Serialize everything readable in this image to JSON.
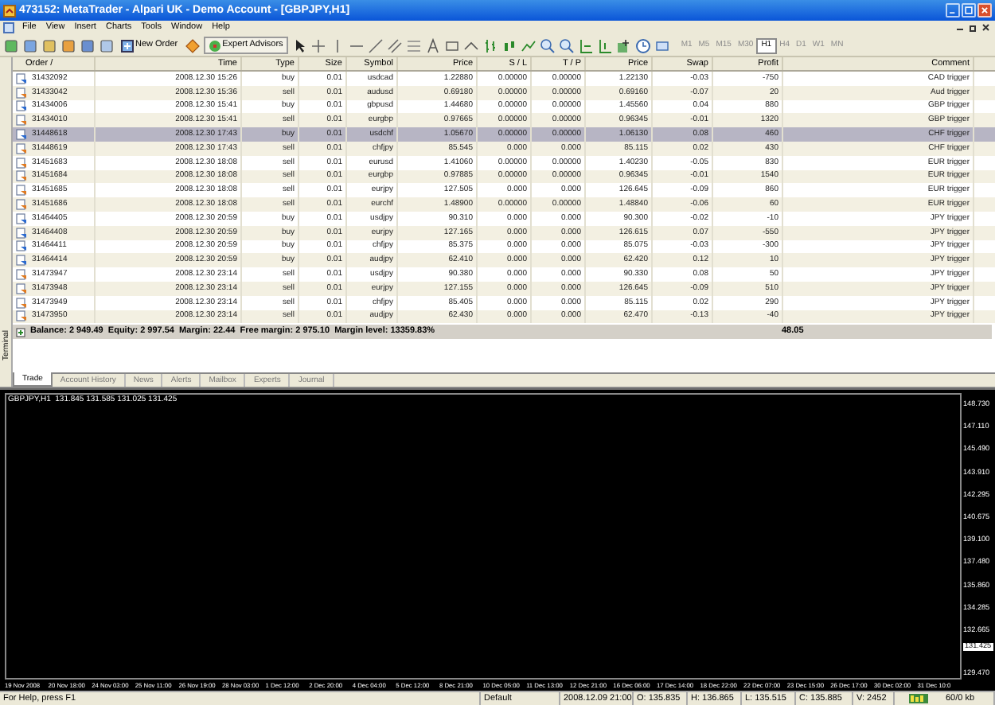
{
  "window": {
    "title": "473152: MetaTrader - Alpari UK - Demo Account - [GBPJPY,H1]"
  },
  "menu": [
    "File",
    "View",
    "Insert",
    "Charts",
    "Tools",
    "Window",
    "Help"
  ],
  "toolbar": {
    "buttons": [
      "New Order",
      "Expert Advisors"
    ],
    "timeframes": [
      {
        "label": "M1",
        "selected": false
      },
      {
        "label": "M5",
        "selected": false
      },
      {
        "label": "M15",
        "selected": false
      },
      {
        "label": "M30",
        "selected": false
      },
      {
        "label": "H1",
        "selected": true
      },
      {
        "label": "H4",
        "selected": false
      },
      {
        "label": "D1",
        "selected": false
      },
      {
        "label": "W1",
        "selected": false
      },
      {
        "label": "MN",
        "selected": false
      }
    ]
  },
  "terminal": {
    "side_label": "Terminal",
    "columns": [
      "Order  /",
      "Time",
      "Type",
      "Size",
      "Symbol",
      "Price",
      "S / L",
      "T / P",
      "Price",
      "Swap",
      "Profit",
      "Comment"
    ],
    "rows": [
      {
        "kind": "buy",
        "selected": false,
        "cells": [
          "31432092",
          "2008.12.30 15:26",
          "buy",
          "0.01",
          "usdcad",
          "1.22880",
          "0.00000",
          "0.00000",
          "1.22130",
          "-0.03",
          "-750",
          "CAD trigger"
        ]
      },
      {
        "kind": "sell",
        "selected": false,
        "cells": [
          "31433042",
          "2008.12.30 15:36",
          "sell",
          "0.01",
          "audusd",
          "0.69180",
          "0.00000",
          "0.00000",
          "0.69160",
          "-0.07",
          "20",
          "Aud trigger"
        ]
      },
      {
        "kind": "buy",
        "selected": false,
        "cells": [
          "31434006",
          "2008.12.30 15:41",
          "buy",
          "0.01",
          "gbpusd",
          "1.44680",
          "0.00000",
          "0.00000",
          "1.45560",
          "0.04",
          "880",
          "GBP trigger"
        ]
      },
      {
        "kind": "sell",
        "selected": false,
        "cells": [
          "31434010",
          "2008.12.30 15:41",
          "sell",
          "0.01",
          "eurgbp",
          "0.97665",
          "0.00000",
          "0.00000",
          "0.96345",
          "-0.01",
          "1320",
          "GBP trigger"
        ]
      },
      {
        "kind": "buy",
        "selected": true,
        "cells": [
          "31448618",
          "2008.12.30 17:43",
          "buy",
          "0.01",
          "usdchf",
          "1.05670",
          "0.00000",
          "0.00000",
          "1.06130",
          "0.08",
          "460",
          "CHF trigger"
        ]
      },
      {
        "kind": "sell",
        "selected": false,
        "cells": [
          "31448619",
          "2008.12.30 17:43",
          "sell",
          "0.01",
          "chfjpy",
          "85.545",
          "0.000",
          "0.000",
          "85.115",
          "0.02",
          "430",
          "CHF trigger"
        ]
      },
      {
        "kind": "sell",
        "selected": false,
        "cells": [
          "31451683",
          "2008.12.30 18:08",
          "sell",
          "0.01",
          "eurusd",
          "1.41060",
          "0.00000",
          "0.00000",
          "1.40230",
          "-0.05",
          "830",
          "EUR trigger"
        ]
      },
      {
        "kind": "sell",
        "selected": false,
        "cells": [
          "31451684",
          "2008.12.30 18:08",
          "sell",
          "0.01",
          "eurgbp",
          "0.97885",
          "0.00000",
          "0.00000",
          "0.96345",
          "-0.01",
          "1540",
          "EUR trigger"
        ]
      },
      {
        "kind": "sell",
        "selected": false,
        "cells": [
          "31451685",
          "2008.12.30 18:08",
          "sell",
          "0.01",
          "eurjpy",
          "127.505",
          "0.000",
          "0.000",
          "126.645",
          "-0.09",
          "860",
          "EUR trigger"
        ]
      },
      {
        "kind": "sell",
        "selected": false,
        "cells": [
          "31451686",
          "2008.12.30 18:08",
          "sell",
          "0.01",
          "eurchf",
          "1.48900",
          "0.00000",
          "0.00000",
          "1.48840",
          "-0.06",
          "60",
          "EUR trigger"
        ]
      },
      {
        "kind": "buy",
        "selected": false,
        "cells": [
          "31464405",
          "2008.12.30 20:59",
          "buy",
          "0.01",
          "usdjpy",
          "90.310",
          "0.000",
          "0.000",
          "90.300",
          "-0.02",
          "-10",
          "JPY trigger"
        ]
      },
      {
        "kind": "buy",
        "selected": false,
        "cells": [
          "31464408",
          "2008.12.30 20:59",
          "buy",
          "0.01",
          "eurjpy",
          "127.165",
          "0.000",
          "0.000",
          "126.615",
          "0.07",
          "-550",
          "JPY trigger"
        ]
      },
      {
        "kind": "buy",
        "selected": false,
        "cells": [
          "31464411",
          "2008.12.30 20:59",
          "buy",
          "0.01",
          "chfjpy",
          "85.375",
          "0.000",
          "0.000",
          "85.075",
          "-0.03",
          "-300",
          "JPY trigger"
        ]
      },
      {
        "kind": "buy",
        "selected": false,
        "cells": [
          "31464414",
          "2008.12.30 20:59",
          "buy",
          "0.01",
          "audjpy",
          "62.410",
          "0.000",
          "0.000",
          "62.420",
          "0.12",
          "10",
          "JPY trigger"
        ]
      },
      {
        "kind": "sell",
        "selected": false,
        "cells": [
          "31473947",
          "2008.12.30 23:14",
          "sell",
          "0.01",
          "usdjpy",
          "90.380",
          "0.000",
          "0.000",
          "90.330",
          "0.08",
          "50",
          "JPY trigger"
        ]
      },
      {
        "kind": "sell",
        "selected": false,
        "cells": [
          "31473948",
          "2008.12.30 23:14",
          "sell",
          "0.01",
          "eurjpy",
          "127.155",
          "0.000",
          "0.000",
          "126.645",
          "-0.09",
          "510",
          "JPY trigger"
        ]
      },
      {
        "kind": "sell",
        "selected": false,
        "cells": [
          "31473949",
          "2008.12.30 23:14",
          "sell",
          "0.01",
          "chfjpy",
          "85.405",
          "0.000",
          "0.000",
          "85.115",
          "0.02",
          "290",
          "JPY trigger"
        ]
      },
      {
        "kind": "sell",
        "selected": false,
        "cells": [
          "31473950",
          "2008.12.30 23:14",
          "sell",
          "0.01",
          "audjpy",
          "62.430",
          "0.000",
          "0.000",
          "62.470",
          "-0.13",
          "-40",
          "JPY trigger"
        ]
      }
    ],
    "summary": {
      "text": "Balance: 2 949.49  Equity: 2 997.54  Margin: 22.44  Free margin: 2 975.10  Margin level: 13359.83%",
      "profit": "48.05"
    },
    "tabs": [
      {
        "label": "Trade",
        "selected": true
      },
      {
        "label": "Account History",
        "selected": false
      },
      {
        "label": "News",
        "selected": false
      },
      {
        "label": "Alerts",
        "selected": false
      },
      {
        "label": "Mailbox",
        "selected": false
      },
      {
        "label": "Experts",
        "selected": false
      },
      {
        "label": "Journal",
        "selected": false
      }
    ]
  },
  "chart": {
    "header": "GBPJPY,H1  131.845 131.585 131.025 131.425",
    "price_axis": [
      {
        "label": "148.730",
        "kind": "tick"
      },
      {
        "label": "147.110",
        "kind": "tick"
      },
      {
        "label": "145.490",
        "kind": "tick"
      },
      {
        "label": "143.910",
        "kind": "tick"
      },
      {
        "label": "142.295",
        "kind": "tick"
      },
      {
        "label": "140.675",
        "kind": "tick"
      },
      {
        "label": "139.100",
        "kind": "tick"
      },
      {
        "label": "137.480",
        "kind": "tick"
      },
      {
        "label": "135.860",
        "kind": "tick"
      },
      {
        "label": "134.285",
        "kind": "tick"
      },
      {
        "label": "132.665",
        "kind": "tick"
      },
      {
        "label": "131.425",
        "kind": "current"
      },
      {
        "label": "129.470",
        "kind": "bottom"
      }
    ],
    "time_axis": [
      "19 Nov 2008",
      "20 Nov 18:00",
      "24 Nov 03:00",
      "25 Nov 11:00",
      "26 Nov 19:00",
      "28 Nov 03:00",
      "1 Dec 12:00",
      "2 Dec 20:00",
      "4 Dec 04:00",
      "5 Dec 12:00",
      "8 Dec 21:00",
      "10 Dec 05:00",
      "11 Dec 13:00",
      "12 Dec 21:00",
      "16 Dec 06:00",
      "17 Dec 14:00",
      "18 Dec 22:00",
      "22 Dec 07:00",
      "23 Dec 15:00",
      "26 Dec 17:00",
      "30 Dec 02:00",
      "31 Dec 10:0"
    ]
  },
  "status_bar": {
    "help": "For Help, press F1",
    "profile": "Default",
    "time": "2008.12.09 21:00",
    "open": "O: 135.835",
    "high": "H: 136.865",
    "low": "L: 135.515",
    "close": "C: 135.885",
    "volume": "V: 2452",
    "traffic": "60/0 kb"
  }
}
